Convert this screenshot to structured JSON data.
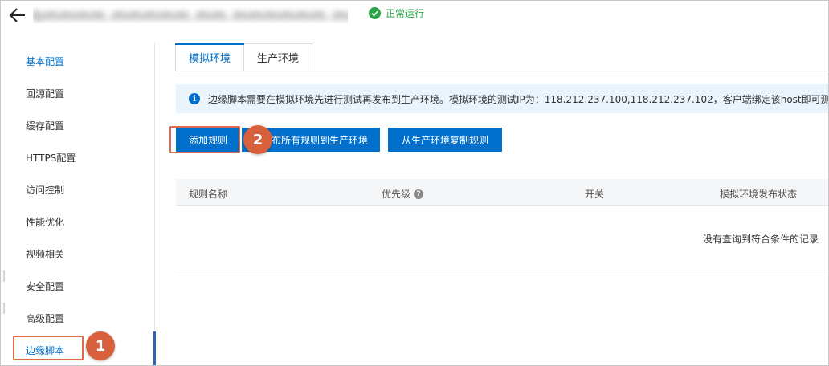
{
  "header": {
    "domain": "bmmmm.mmmmm.mm.mmmmmm.mmmm.dmp",
    "status": "正常运行",
    "status_color": "#2aa344",
    "back_icon": "arrow-left-icon",
    "status_icon": "check-circle-icon"
  },
  "sidebar": {
    "items": [
      {
        "label": "基本配置"
      },
      {
        "label": "回源配置"
      },
      {
        "label": "缓存配置"
      },
      {
        "label": "HTTPS配置"
      },
      {
        "label": "访问控制"
      },
      {
        "label": "性能优化"
      },
      {
        "label": "视频相关"
      },
      {
        "label": "安全配置"
      },
      {
        "label": "高级配置"
      },
      {
        "label": "边缘脚本"
      }
    ],
    "active_index": 9
  },
  "tabs": [
    {
      "label": "模拟环境"
    },
    {
      "label": "生产环境"
    }
  ],
  "notice": {
    "icon": "info-icon",
    "text": "边缘脚本需要在模拟环境先进行测试再发布到生产环境。模拟环境的测试IP为：118.212.237.100,118.212.237.102，客户端绑定该host即可测试模拟环境"
  },
  "buttons": {
    "add": "添加规则",
    "publish": "布所有规则到生产环境",
    "copy": "从生产环境复制规则"
  },
  "table": {
    "columns": [
      {
        "label": "规则名称"
      },
      {
        "label": "优先级"
      },
      {
        "label": "开关"
      },
      {
        "label": "模拟环境发布状态"
      }
    ],
    "empty_text": "没有查询到符合条件的记录"
  },
  "annotations": {
    "step1": "1",
    "step2": "2",
    "color": "#d9603d"
  },
  "accent_color": "#0070cc"
}
